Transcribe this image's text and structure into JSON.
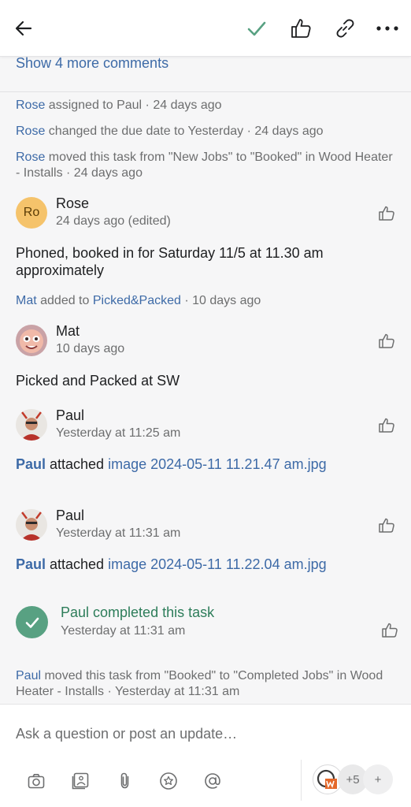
{
  "header": {
    "back_icon": "arrow-left-icon",
    "complete_icon": "check-icon",
    "like_icon": "thumbs-up-icon",
    "link_icon": "link-icon",
    "more_icon": "more-horizontal-icon"
  },
  "show_more": "Show 4 more comments",
  "activities": [
    {
      "name": "Rose",
      "text": " assigned to Paul · 24 days ago"
    },
    {
      "name": "Rose",
      "text": " changed the due date to Yesterday · 24 days ago"
    },
    {
      "name": "Rose",
      "text": " moved this task from \"New Jobs\" to \"Booked\" in Wood Heater - Installs · 24 days ago"
    }
  ],
  "comment_rose": {
    "initials": "Ro",
    "author": "Rose",
    "time": "24 days ago (edited)",
    "body": "Phoned, booked in for Saturday 11/5 at 11.30 am approximately"
  },
  "tag_activity": {
    "name": "Mat",
    "pre": " added to ",
    "tag": "Picked&Packed",
    "post": " · 10 days ago"
  },
  "comment_mat": {
    "author": "Mat",
    "time": "10 days ago",
    "body": "Picked and Packed at SW"
  },
  "paul_1": {
    "author": "Paul",
    "time": "Yesterday at 11:25 am",
    "attach_name": "Paul",
    "attach_verb": " attached ",
    "attach_file": "image 2024-05-11 11.21.47 am.jpg"
  },
  "paul_2": {
    "author": "Paul",
    "time": "Yesterday at 11:31 am",
    "attach_name": "Paul",
    "attach_verb": " attached ",
    "attach_file": "image 2024-05-11 11.22.04 am.jpg"
  },
  "completed": {
    "text": "Paul completed this task",
    "time": "Yesterday at 11:31 am"
  },
  "final_activity": {
    "name": "Paul",
    "text": " moved this task from \"Booked\" to \"Completed Jobs\" in Wood Heater - Installs · Yesterday at 11:31 am"
  },
  "composer": {
    "placeholder": "Ask a question or post an update…",
    "tools": [
      "camera-icon",
      "photo-library-icon",
      "paperclip-icon",
      "star-icon",
      "mention-icon"
    ],
    "collab_more": "+5",
    "add_collab": "+"
  },
  "colors": {
    "accent": "#3d6aa7",
    "success": "#58a182",
    "rose_avatar": "#f5c36b"
  }
}
